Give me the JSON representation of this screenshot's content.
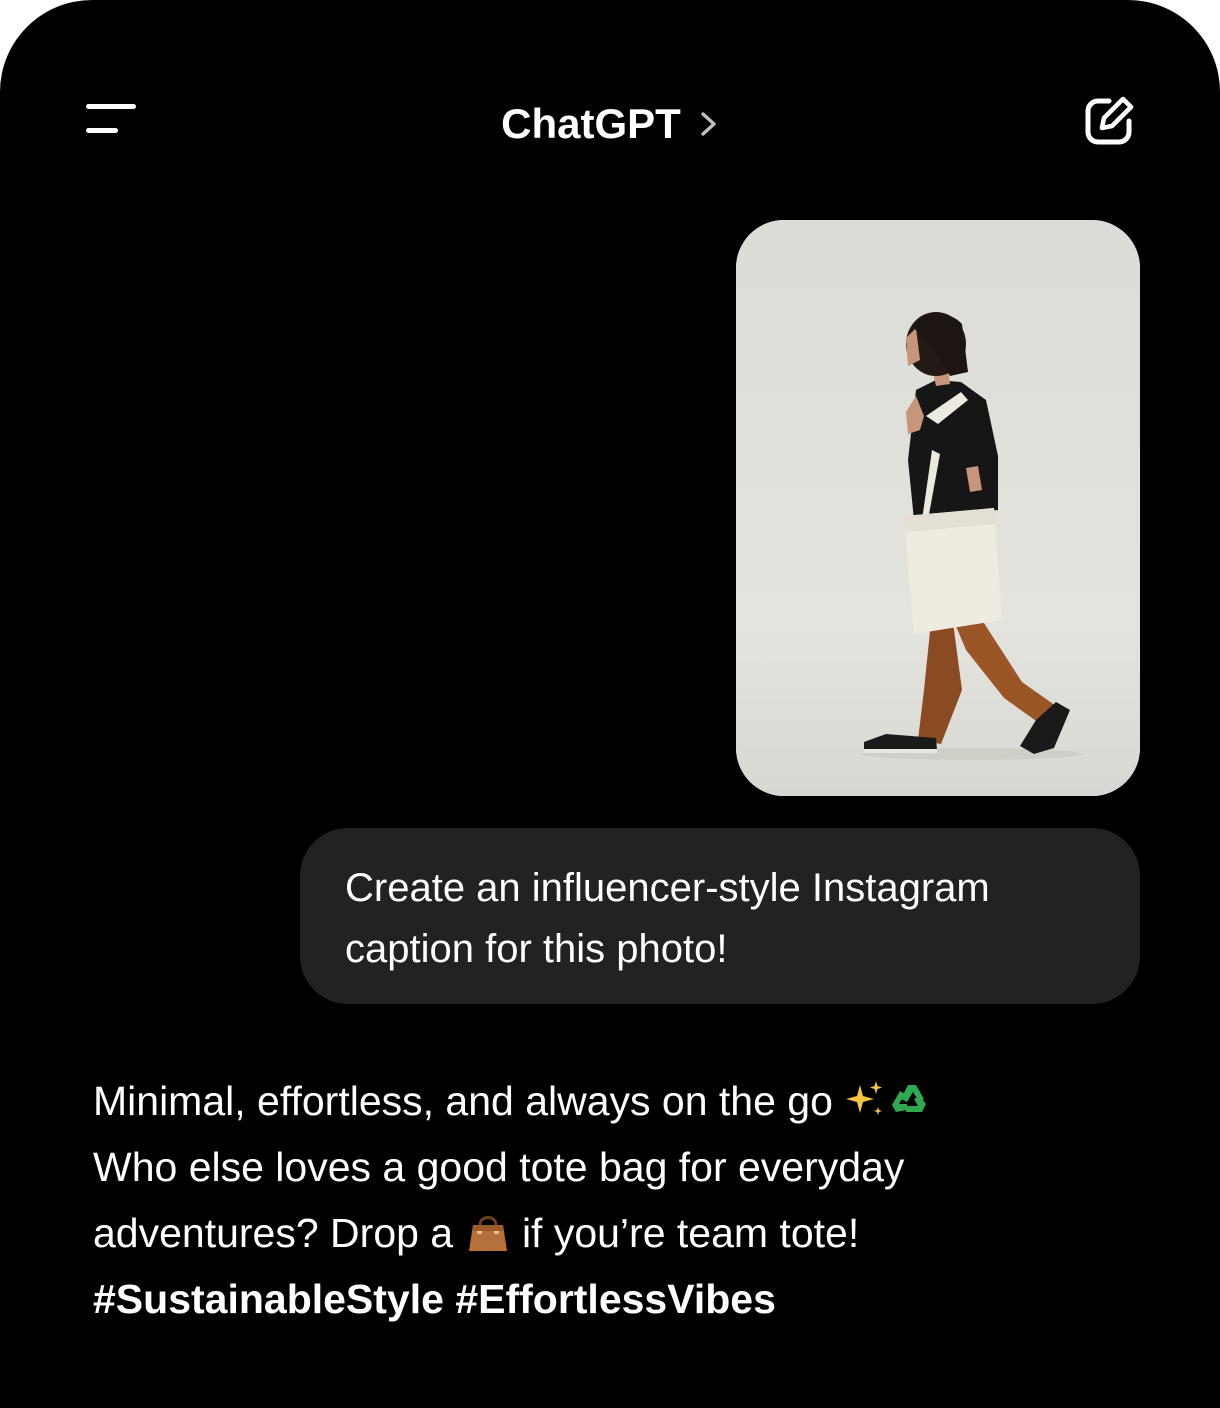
{
  "header": {
    "title": "ChatGPT",
    "menu_icon": "menu-icon",
    "title_chevron_icon": "chevron-right-icon",
    "compose_icon": "new-chat-compose-icon"
  },
  "conversation": {
    "user_image": {
      "icon": "photo-thumbnail"
    },
    "user_message": {
      "line1": "Create an influencer-style Instagram",
      "line2": "caption for this photo!"
    },
    "assistant_message": {
      "line1": "Minimal, effortless, and always on the go",
      "line1_emojis": "sparkles-and-recycle-emoji",
      "line2": "Who else loves a good tote bag for everyday",
      "line3_start": "adventures? Drop a",
      "line3_emoji": "handbag-emoji",
      "line3_end": "if you’re team tote!",
      "hashtags": "#SustainableStyle #EffortlessVibes"
    }
  },
  "colors": {
    "background": "#000000",
    "bubble": "#222222",
    "text": "#ffffff",
    "photo_backdrop": "#e2e2dc"
  }
}
